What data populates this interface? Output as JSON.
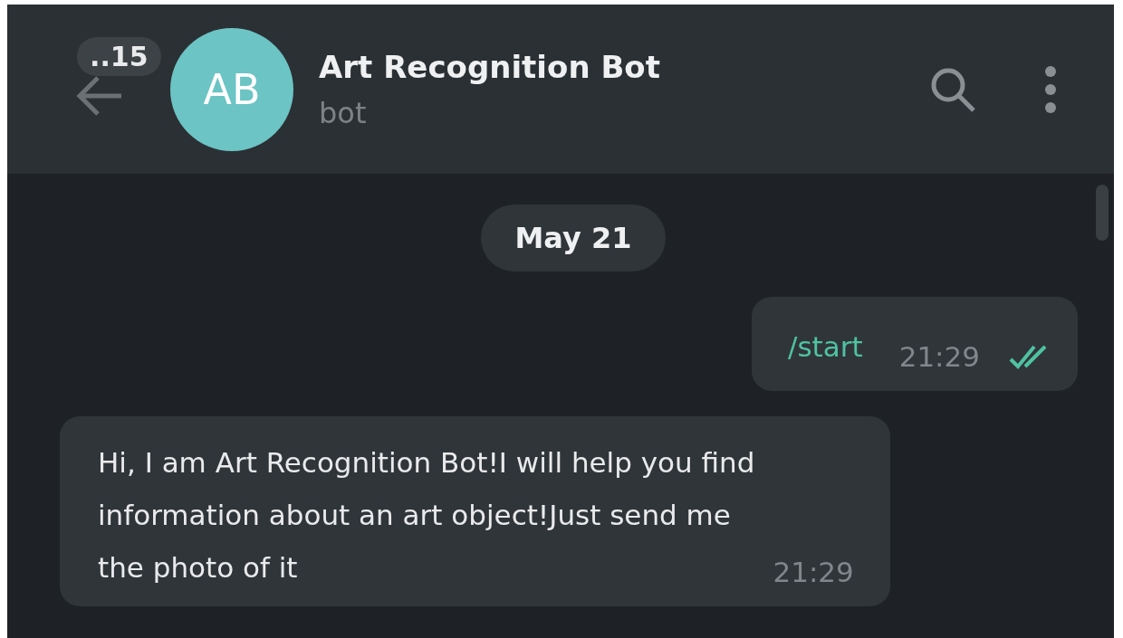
{
  "header": {
    "back_badge": "..15",
    "avatar_initials": "AB",
    "title": "Art Recognition Bot",
    "subtitle": "bot"
  },
  "date_separator": "May 21",
  "messages": [
    {
      "kind": "outgoing",
      "text": "/start",
      "time": "21:29",
      "read": true
    },
    {
      "kind": "incoming",
      "text": "Hi, I am Art Recognition Bot!I will help you find\ninformation about an art object!Just send me\nthe photo of it",
      "time": "21:29"
    }
  ]
}
